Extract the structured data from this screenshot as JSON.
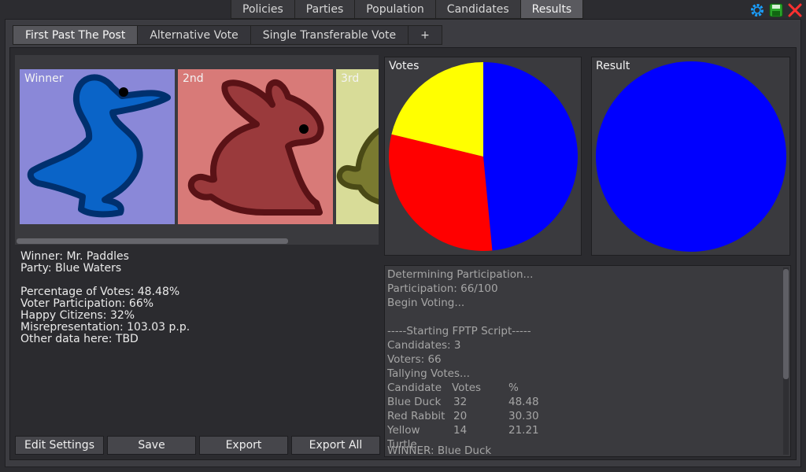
{
  "top_tabs": [
    "Policies",
    "Parties",
    "Population",
    "Candidates",
    "Results"
  ],
  "active_top_tab": "Results",
  "top_icons": [
    "gear-icon",
    "save-icon",
    "close-icon"
  ],
  "sub_tabs": [
    "First Past The Post",
    "Alternative Vote",
    "Single Transferable Vote",
    "+"
  ],
  "active_sub_tab": "First Past The Post",
  "cards": [
    {
      "label": "Winner",
      "animal": "duck",
      "bg": "#8a88d8",
      "fill": "#0a64c8",
      "outline": "#00306e"
    },
    {
      "label": "2nd",
      "animal": "rabbit",
      "bg": "#d87a78",
      "fill": "#9a3a3c",
      "outline": "#5a1216"
    },
    {
      "label": "3rd",
      "animal": "turtle",
      "bg": "#d8dc98",
      "fill": "#7a7a30",
      "outline": "#4a4a16"
    }
  ],
  "stats": {
    "winner": "Winner: Mr. Paddles",
    "party": "Party: Blue Waters",
    "votes": "Percentage of Votes: 48.48%",
    "participation": "Voter Participation: 66%",
    "happy": "Happy Citizens: 32%",
    "misrep": "Misrepresentation: 103.03 p.p.",
    "other": "Other data here: TBD"
  },
  "votes_chart": {
    "title": "Votes"
  },
  "result_chart": {
    "title": "Result"
  },
  "chart_data": [
    {
      "type": "pie",
      "title": "Votes",
      "categories": [
        "Blue",
        "Red",
        "Yellow"
      ],
      "values": [
        48.48,
        30.3,
        21.21
      ],
      "colors": [
        "#0000ff",
        "#ff0000",
        "#ffff00"
      ]
    },
    {
      "type": "pie",
      "title": "Result",
      "categories": [
        "Blue"
      ],
      "values": [
        100
      ],
      "colors": [
        "#0000ff"
      ]
    }
  ],
  "log": {
    "lines": [
      "Determining Participation...",
      "Participation: 66/100",
      "Begin Voting...",
      "",
      "-----Starting FPTP Script-----",
      "Candidates: 3",
      "Voters: 66",
      "Tallying Votes..."
    ],
    "table_header": [
      "Candidate",
      "Votes",
      "%"
    ],
    "table_rows": [
      [
        "Blue Duck",
        "32",
        "48.48"
      ],
      [
        "Red Rabbit",
        "20",
        "30.30"
      ],
      [
        "Yellow Turtle",
        "14",
        "21.21"
      ]
    ],
    "tail": "WINNER: Blue Duck"
  },
  "buttons": [
    "Edit Settings",
    "Save",
    "Export",
    "Export All"
  ]
}
